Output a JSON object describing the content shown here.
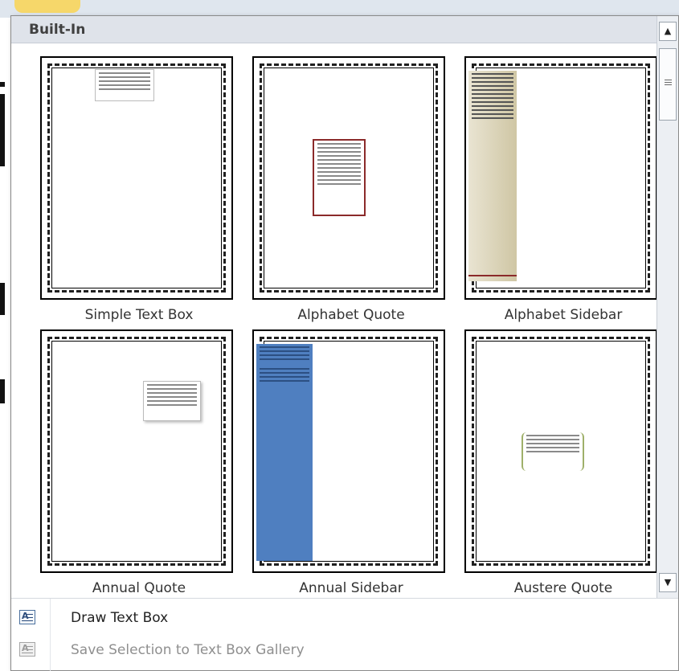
{
  "gallery": {
    "header": "Built-In",
    "items": [
      {
        "label": "Simple Text Box"
      },
      {
        "label": "Alphabet Quote"
      },
      {
        "label": "Alphabet Sidebar"
      },
      {
        "label": "Annual Quote"
      },
      {
        "label": "Annual Sidebar"
      },
      {
        "label": "Austere Quote"
      }
    ]
  },
  "menu": {
    "draw_text_box": "Draw Text Box",
    "save_selection": "Save Selection to Text Box Gallery"
  },
  "icons": {
    "scroll_up": "scroll-up-arrow-icon",
    "scroll_down": "scroll-down-arrow-icon",
    "draw_text_box": "text-box-icon",
    "save_selection": "save-text-box-icon"
  },
  "colors": {
    "header_bg": "#dfe3ea",
    "sidebar_blue": "#4f7fc0",
    "sidebar_tan": "#d8d0b5",
    "quote_border": "#8b2a2a",
    "austere_bracket": "#9fb06a"
  }
}
